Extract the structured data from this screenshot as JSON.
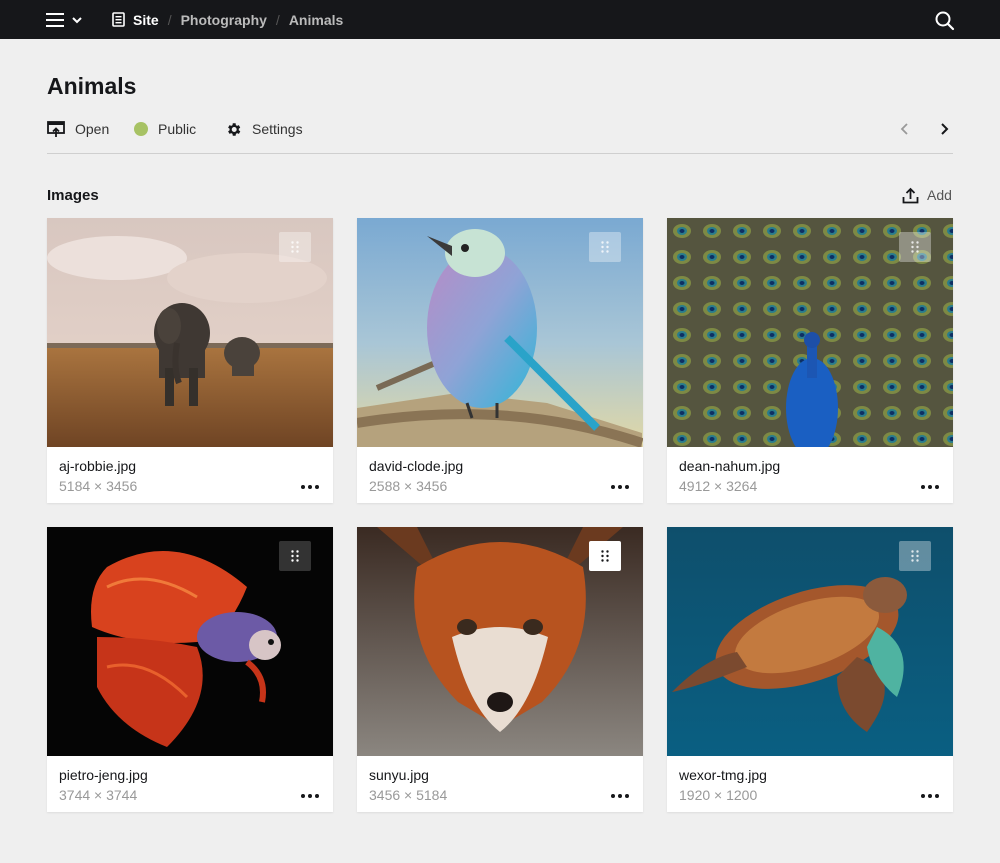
{
  "topbar": {
    "breadcrumb": [
      {
        "label": "Site",
        "icon": "document-icon"
      },
      {
        "label": "Photography"
      },
      {
        "label": "Animals"
      }
    ]
  },
  "page": {
    "title": "Animals",
    "actions": {
      "open_label": "Open",
      "status_label": "Public",
      "status_color": "#a7c264",
      "settings_label": "Settings"
    }
  },
  "section": {
    "title": "Images",
    "add_label": "Add"
  },
  "images": [
    {
      "name": "aj-robbie.jpg",
      "dims": "5184 × 3456",
      "subject": "elephants"
    },
    {
      "name": "david-clode.jpg",
      "dims": "2588 × 3456",
      "subject": "roller-bird"
    },
    {
      "name": "dean-nahum.jpg",
      "dims": "4912 × 3264",
      "subject": "peacock"
    },
    {
      "name": "pietro-jeng.jpg",
      "dims": "3744 × 3744",
      "subject": "betta-fish"
    },
    {
      "name": "sunyu.jpg",
      "dims": "3456 × 5184",
      "subject": "fox"
    },
    {
      "name": "wexor-tmg.jpg",
      "dims": "1920 × 1200",
      "subject": "sea-turtle"
    }
  ],
  "colors": {
    "topbar_bg": "#16171a",
    "page_bg": "#efefef",
    "accent_status": "#a7c264"
  }
}
